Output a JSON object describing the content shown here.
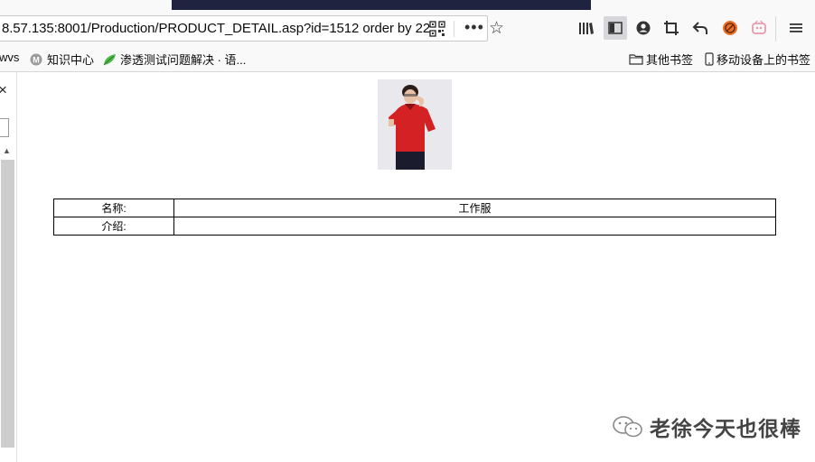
{
  "browser": {
    "url_host": "8.57.135",
    "url_rest": ":8001/Production/PRODUCT_DETAIL.asp?id=1512 order by 22",
    "bookmarks": [
      {
        "label": "wvs",
        "icon": "none"
      },
      {
        "label": "知识中心",
        "icon": "m-circle-icon"
      },
      {
        "label": "渗透测试问题解决 · 语...",
        "icon": "leaf-icon"
      }
    ],
    "bookmark_folders": [
      {
        "label": "其他书签",
        "icon": "folder-icon"
      },
      {
        "label": "移动设备上的书签",
        "icon": "phone-icon"
      }
    ]
  },
  "left_panel": {
    "close_symbol": "×"
  },
  "product": {
    "image_alt": "red work uniform",
    "rows": [
      {
        "label": "名称:",
        "value": "工作服"
      },
      {
        "label": "介绍:",
        "value": ""
      }
    ]
  },
  "watermark": {
    "text": "老徐今天也很棒"
  }
}
